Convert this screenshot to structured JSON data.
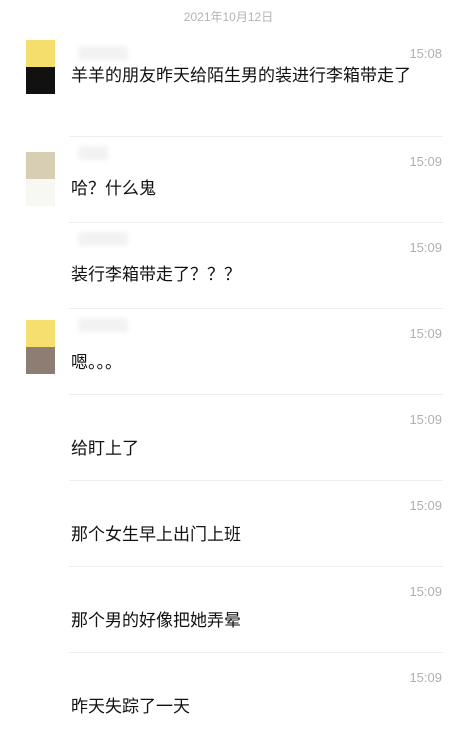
{
  "date_divider": "2021年10月12日",
  "messages": [
    {
      "time": "15:08",
      "text": "羊羊的朋友昨天给陌生男的装进行李箱带走了"
    },
    {
      "time": "15:09",
      "text": "哈？什么鬼"
    },
    {
      "time": "15:09",
      "text": "装行李箱带走了？？？"
    },
    {
      "time": "15:09",
      "text": "嗯。。。"
    },
    {
      "time": "15:09",
      "text": "给盯上了"
    },
    {
      "time": "15:09",
      "text": "那个女生早上出门上班"
    },
    {
      "time": "15:09",
      "text": "那个男的好像把她弄晕"
    },
    {
      "time": "15:09",
      "text": "昨天失踪了一天"
    }
  ],
  "colors": {
    "avatar_a_top": "#f5de6b",
    "avatar_a_bottom": "#111111",
    "avatar_b_top": "#d8ceb3",
    "avatar_b_bottom": "#f6f8f1",
    "avatar_c_top": "#f7df6f",
    "avatar_c_bottom": "#8e7d72"
  }
}
